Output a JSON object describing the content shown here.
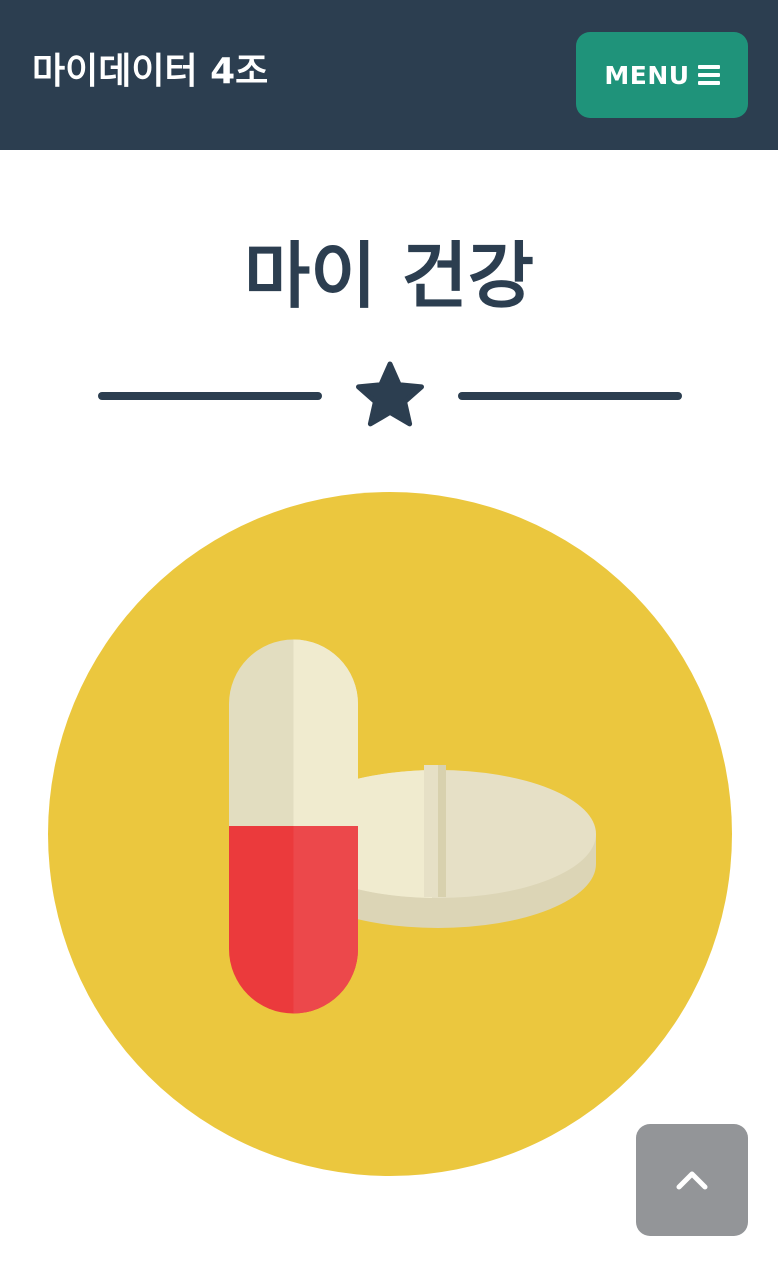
{
  "navbar": {
    "brand": "마이데이터 4조",
    "menu_label": "MENU",
    "menu_icon": "hamburger-icon",
    "background": "#2c3e50",
    "menu_button_color": "#1f937a"
  },
  "main": {
    "title": "마이 건강",
    "divider_icon": "star-icon",
    "illustration": "pills-icon",
    "illustration_background": "#ebc73e"
  },
  "scroll_top": {
    "icon": "chevron-up-icon",
    "background": "#939598"
  }
}
